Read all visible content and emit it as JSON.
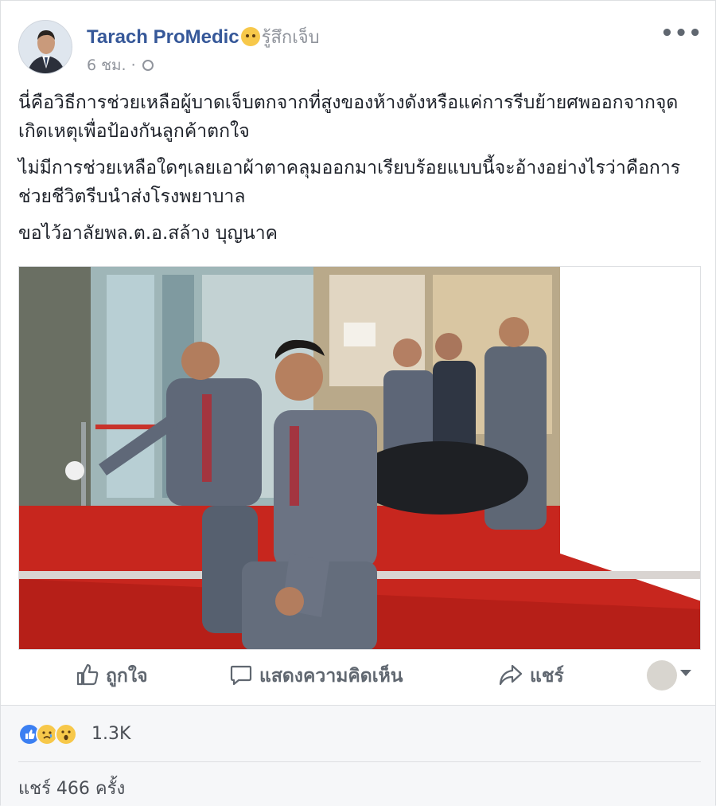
{
  "post": {
    "author": "Tarach ProMedic",
    "feeling": "รู้สึกเจ็บ",
    "time": "6 ชม. ·",
    "paragraphs": [
      "นี่คือวิธีการช่วยเหลือผู้บาดเจ็บตกจากที่สูงของห้างดังหรือแค่การรีบย้ายศพออกจากจุดเกิดเหตุเพื่อป้องกันลูกค้าตกใจ",
      "ไม่มีการช่วยเหลือใดๆเลยเอาผ้าตาคลุมออกมาเรียบร้อยแบบนี้จะอ้างอย่างไรว่าคือการช่วยชีวิตรีบนำส่งโรงพยาบาล",
      "ขอไว้อาลัยพล.ต.อ.สล้าง บุญนาค"
    ]
  },
  "actions": {
    "like": "ถูกใจ",
    "comment": "แสดงความคิดเห็น",
    "share": "แชร์"
  },
  "stats": {
    "reactions_count": "1.3K",
    "shares": "แชร์ 466 ครั้ง"
  },
  "icons": [
    "globe-icon",
    "more-icon",
    "like-icon",
    "comment-icon",
    "share-icon",
    "caret-down-icon"
  ],
  "colors": {
    "author": "#365899",
    "muted": "#90949c",
    "like_reaction": "#3b7ff2",
    "floor_red": "#c7261e"
  }
}
